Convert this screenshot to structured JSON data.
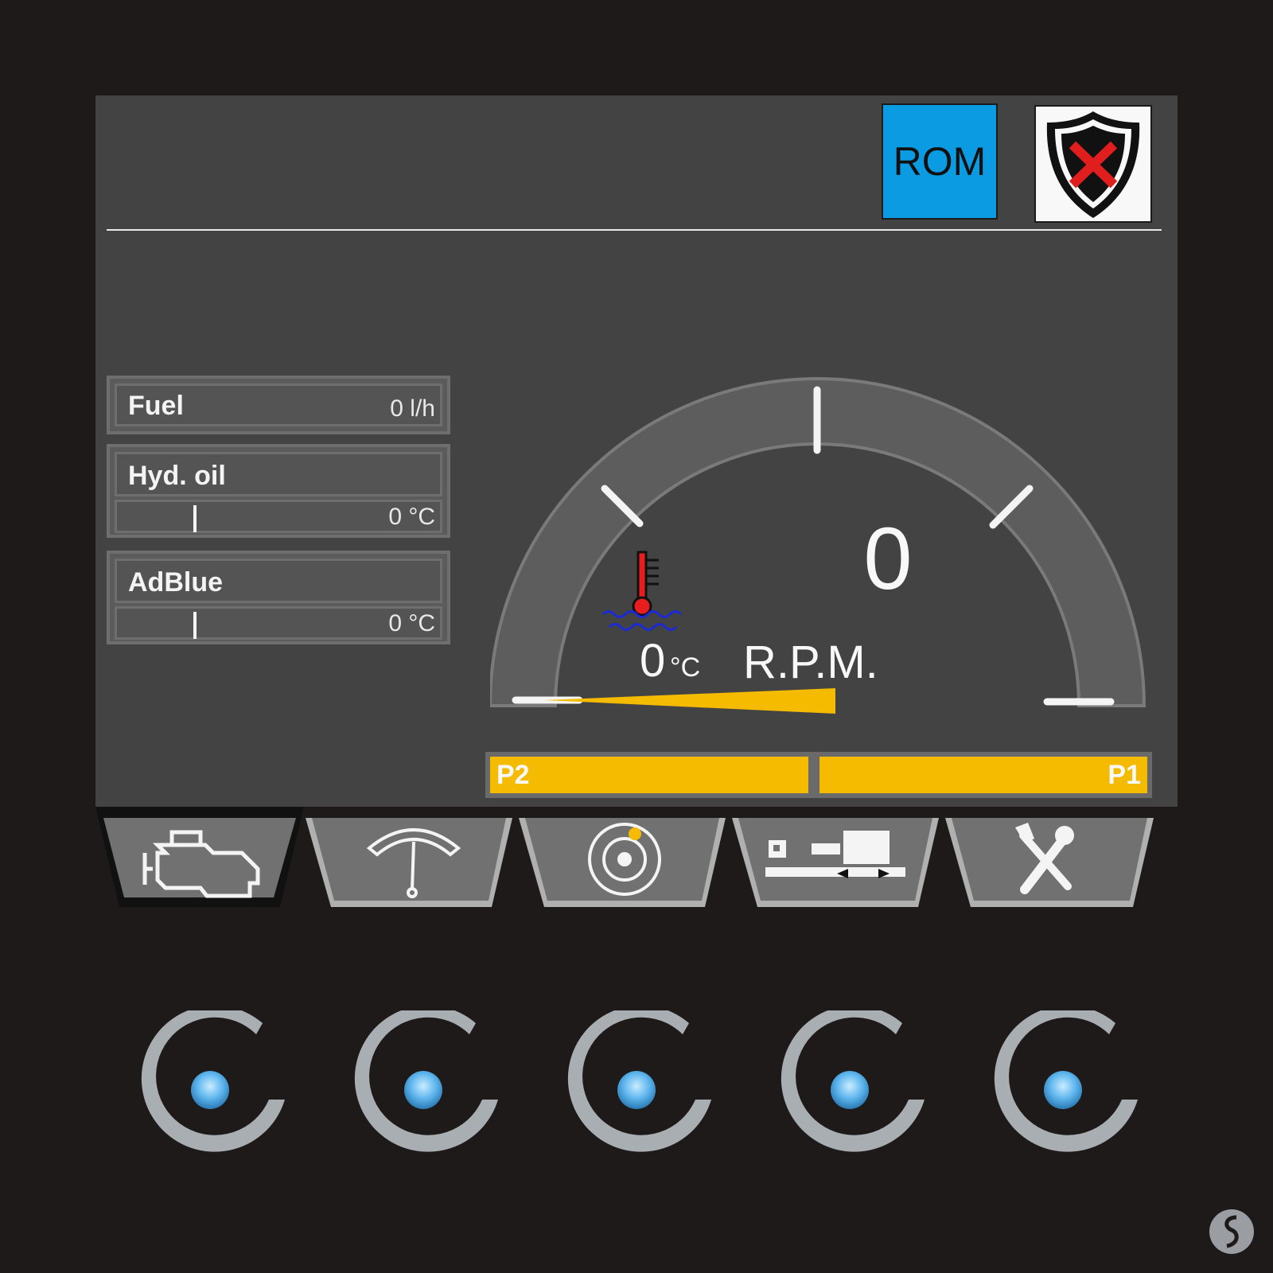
{
  "header": {
    "rom_label": "ROM",
    "shield_icon": "shield-error-icon"
  },
  "readouts": {
    "fuel": {
      "label": "Fuel",
      "value": "0 l/h"
    },
    "hyd_oil": {
      "label": "Hyd. oil",
      "value": "0 °C"
    },
    "adblue": {
      "label": "AdBlue",
      "value": "0 °C"
    }
  },
  "gauge": {
    "rpm_value": "0",
    "rpm_label": "R.P.M.",
    "coolant_temp_value": "0",
    "coolant_temp_unit": "°C",
    "coolant_icon": "coolant-temperature-icon",
    "needle_color": "#f4bb00"
  },
  "pump_bars": {
    "left_label": "P2",
    "right_label": "P1",
    "color": "#f4bb00"
  },
  "tabs": [
    {
      "name": "engine",
      "icon": "engine-icon",
      "selected": true
    },
    {
      "name": "gauge",
      "icon": "gauge-icon",
      "selected": false
    },
    {
      "name": "target",
      "icon": "target-icon",
      "selected": false
    },
    {
      "name": "machine",
      "icon": "machine-icon",
      "selected": false
    },
    {
      "name": "tools",
      "icon": "tools-icon",
      "selected": false
    }
  ],
  "hardware_buttons": [
    {
      "name": "softkey-1",
      "icon": "softkey-led-icon"
    },
    {
      "name": "softkey-2",
      "icon": "softkey-led-icon"
    },
    {
      "name": "softkey-3",
      "icon": "softkey-led-icon"
    },
    {
      "name": "softkey-4",
      "icon": "softkey-led-icon"
    },
    {
      "name": "softkey-5",
      "icon": "softkey-led-icon"
    }
  ],
  "colors": {
    "rom_bg": "#0a9be2",
    "screen_bg": "#434343",
    "led": "#5fb6ee"
  }
}
